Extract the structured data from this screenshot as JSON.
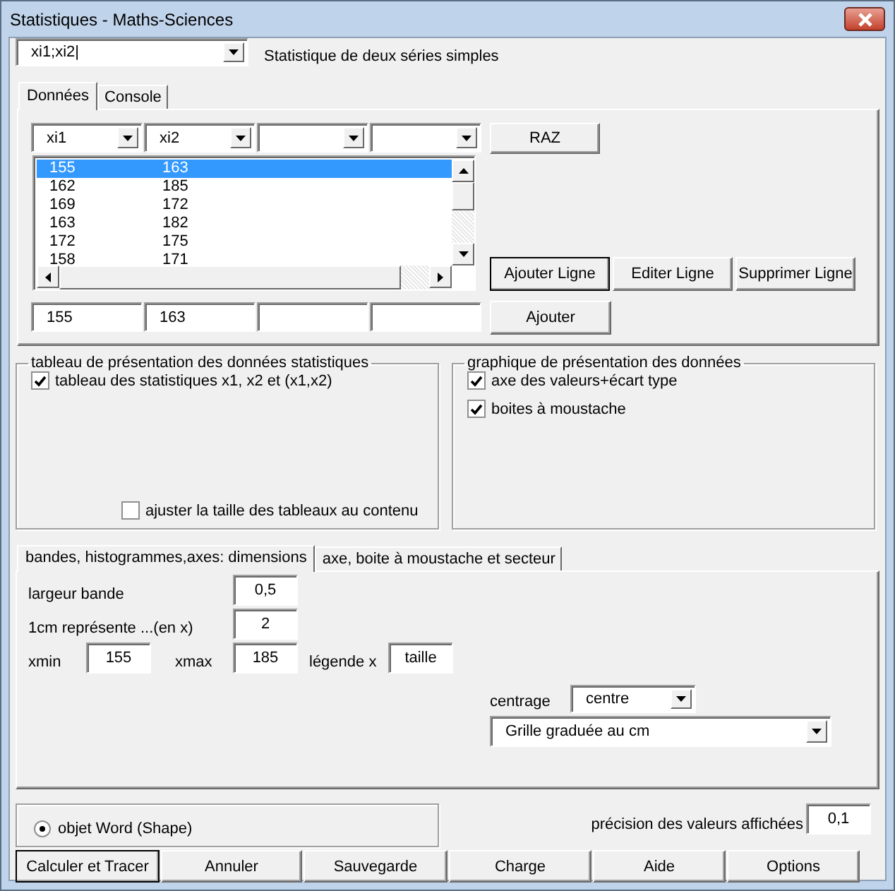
{
  "window": {
    "title": "Statistiques - Maths-Sciences"
  },
  "mode": {
    "value": "xi1;xi2|",
    "label": "Statistique de deux séries simples"
  },
  "tabs": [
    {
      "label": "Données",
      "selected": true
    },
    {
      "label": "Console",
      "selected": false
    }
  ],
  "data_tab": {
    "column_selectors": [
      "xi1",
      "xi2"
    ],
    "rows": [
      {
        "cells": [
          "155",
          "163"
        ],
        "selected": true
      },
      {
        "cells": [
          "162",
          "185"
        ],
        "selected": false
      },
      {
        "cells": [
          "169",
          "172"
        ],
        "selected": false
      },
      {
        "cells": [
          "163",
          "182"
        ],
        "selected": false
      },
      {
        "cells": [
          "172",
          "175"
        ],
        "selected": false
      },
      {
        "cells": [
          "158",
          "171"
        ],
        "selected": false
      }
    ],
    "reset_button": "RAZ",
    "row_buttons": [
      {
        "label": "Ajouter Ligne",
        "default": true
      },
      {
        "label": "Editer Ligne",
        "default": false
      },
      {
        "label": "Supprimer Ligne",
        "default": false
      }
    ],
    "entry": [
      "155",
      "163"
    ],
    "add_button": "Ajouter"
  },
  "frames": [
    {
      "title": "tableau de présentation des données statistiques",
      "options": [
        {
          "label": "tableau des statistiques x1, x2 et (x1,x2)",
          "checked": true
        },
        {
          "label": "ajuster la taille des tableaux au contenu",
          "checked": false
        }
      ]
    },
    {
      "title": "graphique de présentation des données",
      "options": [
        {
          "label": "axe des valeurs+écart type",
          "checked": true
        },
        {
          "label": "boites à moustache",
          "checked": true
        }
      ]
    }
  ],
  "chart_tabs": [
    {
      "label": "bandes, histogrammes,axes: dimensions",
      "selected": true
    },
    {
      "label": "axe, boite à moustache et secteur",
      "selected": false
    }
  ],
  "dimensions": {
    "band_width": {
      "label": "largeur bande",
      "value": "0,5"
    },
    "scale": {
      "label": "1cm représente ...(en x)",
      "value": "2"
    },
    "xmin": {
      "label": "xmin",
      "value": "155"
    },
    "xmax": {
      "label": "xmax",
      "value": "185"
    },
    "legend": {
      "label": "légende x",
      "value": "taille"
    },
    "centering": {
      "label": "centrage",
      "value": "centre"
    },
    "grid": {
      "value": "Grille graduée au cm"
    }
  },
  "output": {
    "label": "objet Word (Shape)",
    "selected": true
  },
  "precision": {
    "label": "précision des valeurs affichées",
    "value": "0,1"
  },
  "buttons": [
    {
      "label": "Calculer et Tracer",
      "default": true
    },
    {
      "label": "Annuler",
      "default": false
    },
    {
      "label": "Sauvegarde",
      "default": false
    },
    {
      "label": "Charge",
      "default": false
    },
    {
      "label": "Aide",
      "default": false
    },
    {
      "label": "Options",
      "default": false
    }
  ]
}
